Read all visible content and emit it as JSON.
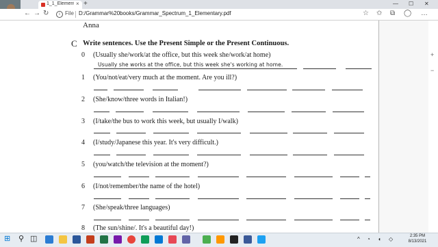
{
  "browser": {
    "tab_title": "1_1_Elementa",
    "address_scheme": "File",
    "address_path": "D:/Grammar%20books/Grammar_Spectrum_1_Elementary.pdf"
  },
  "pdf": {
    "top_name": "Anna",
    "section_letter": "C",
    "instruction": "Write sentences. Use the Present Simple or the Present Continuous.",
    "example_number": "0",
    "example_prompt": "(Usually she/work/at the office, but this week she/work/at home)",
    "example_answer": "Usually she works at the office, but this week she's working at home.",
    "items": [
      {
        "number": "1",
        "prompt": "(You/not/eat/very much at the moment. Are you ill?)"
      },
      {
        "number": "2",
        "prompt": "(She/know/three words in Italian!)"
      },
      {
        "number": "3",
        "prompt": "(I/take/the bus to work this week, but usually I/walk)"
      },
      {
        "number": "4",
        "prompt": "(I/study/Japanese this year. It's very difficult.)"
      },
      {
        "number": "5",
        "prompt": "(you/watch/the television at the moment?)"
      },
      {
        "number": "6",
        "prompt": "(I/not/remember/the name of the hotel)"
      },
      {
        "number": "7",
        "prompt": "(She/speak/three languages)"
      },
      {
        "number": "8",
        "prompt": "(The sun/shine/. It's a beautiful day!)"
      }
    ]
  },
  "taskbar": {
    "time": "2:35 PM",
    "date": "8/13/2021"
  },
  "icons": {
    "tab": "pdf-icon",
    "back": "back-arrow-icon",
    "forward": "forward-arrow-icon",
    "refresh": "refresh-icon",
    "home": "home-icon",
    "info": "info-icon",
    "collections": "collections-icon",
    "favorites": "favorites-icon",
    "menu": "more-menu-icon"
  }
}
